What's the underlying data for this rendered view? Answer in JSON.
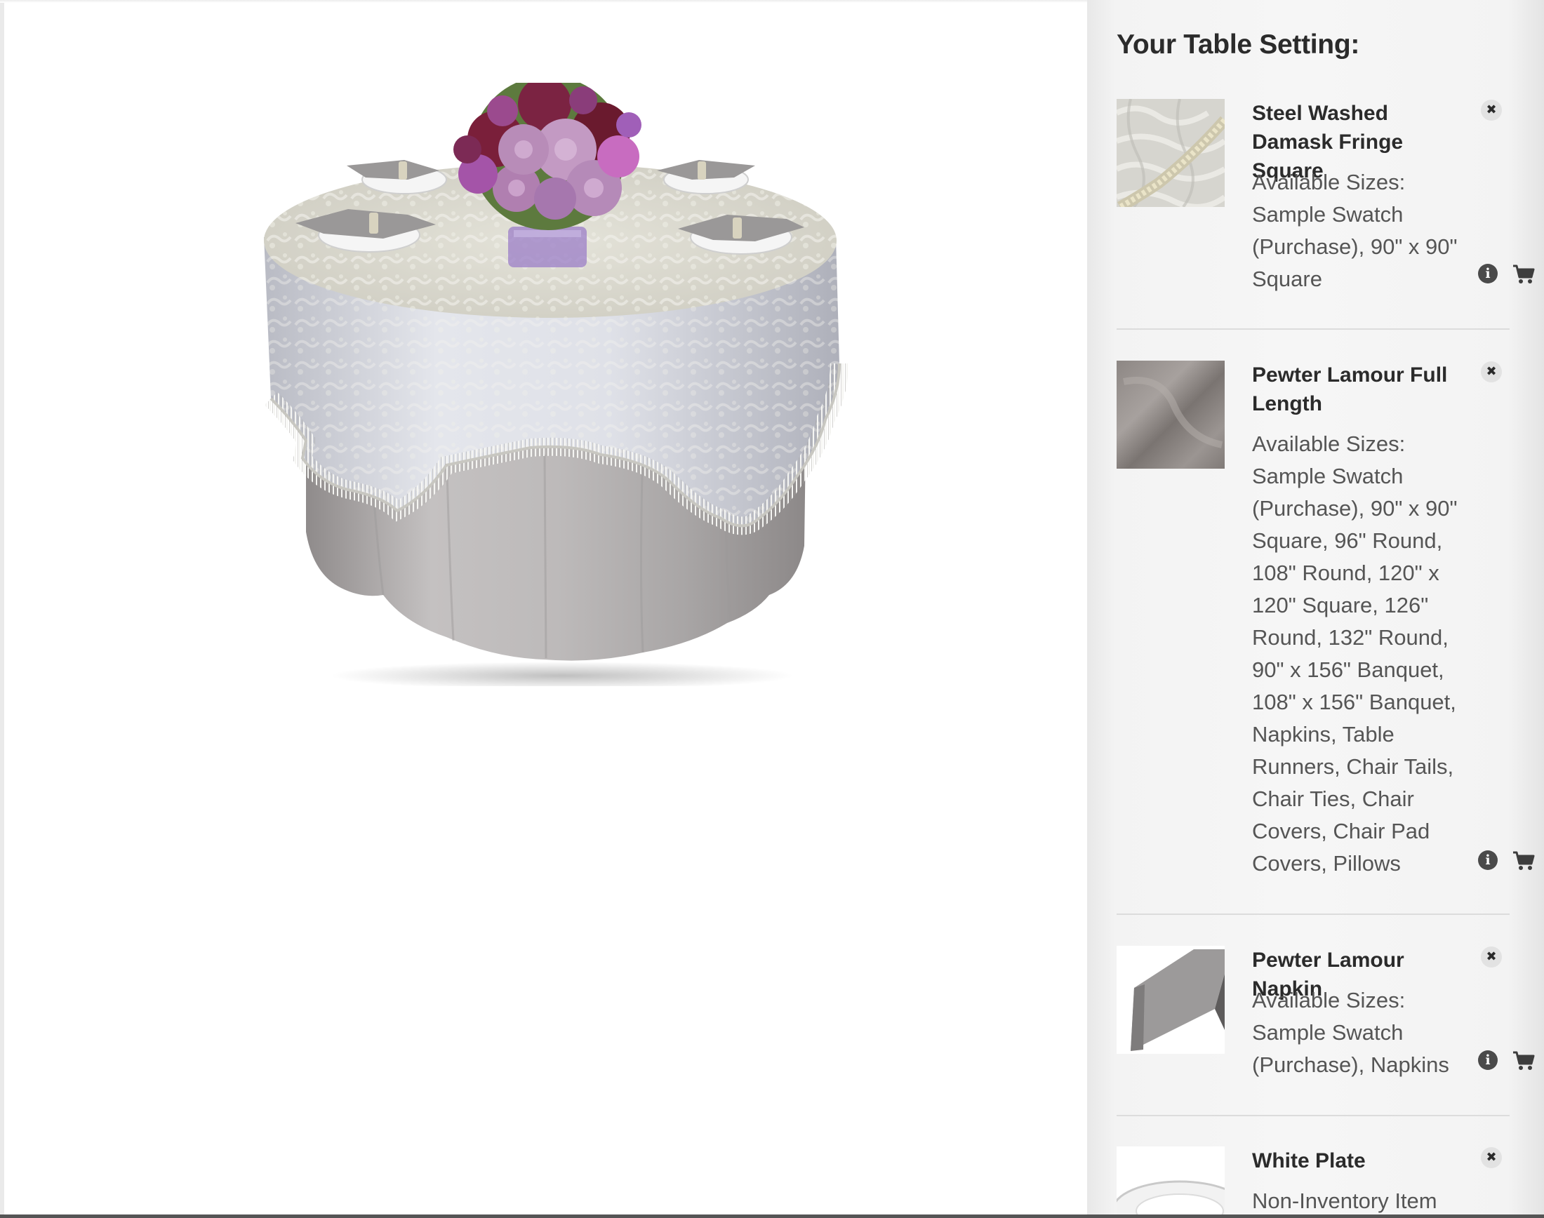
{
  "sidebar": {
    "title": "Your Table Setting:",
    "items": [
      {
        "name": "Steel Washed Damask Fringe Square",
        "sizes": "Available Sizes: Sample Swatch (Purchase), 90\" x 90\" Square",
        "thumb_icon": "damask-fabric-swatch",
        "remove_icon": "close-icon",
        "info_icon": "info-icon",
        "cart_icon": "cart-icon"
      },
      {
        "name": "Pewter Lamour Full Length",
        "sizes": "Available Sizes: Sample Swatch (Purchase), 90\" x 90\" Square, 96\" Round, 108\" Round, 120\" x 120\" Square, 126\" Round, 132\" Round, 90\" x 156\" Banquet, 108\" x 156\" Banquet, Napkins, Table Runners, Chair Tails, Chair Ties, Chair Covers, Chair Pad Covers, Pillows",
        "thumb_icon": "satin-fabric-swatch",
        "remove_icon": "close-icon",
        "info_icon": "info-icon",
        "cart_icon": "cart-icon"
      },
      {
        "name": "Pewter Lamour Napkin",
        "sizes": "Available Sizes: Sample Swatch (Purchase), Napkins",
        "thumb_icon": "napkin-image",
        "remove_icon": "close-icon",
        "info_icon": "info-icon",
        "cart_icon": "cart-icon"
      },
      {
        "name": "White Plate",
        "sizes": "Non-Inventory Item",
        "thumb_icon": "plate-image",
        "remove_icon": "close-icon"
      }
    ]
  },
  "colors": {
    "sidebar_bg": "#f3f3f3",
    "heading": "#2b2b2b",
    "body_text": "#555555",
    "tablecloth_overlay": "#d9dbe0",
    "tablecloth_base": "#b9b6b6",
    "napkin": "#9a9898"
  }
}
